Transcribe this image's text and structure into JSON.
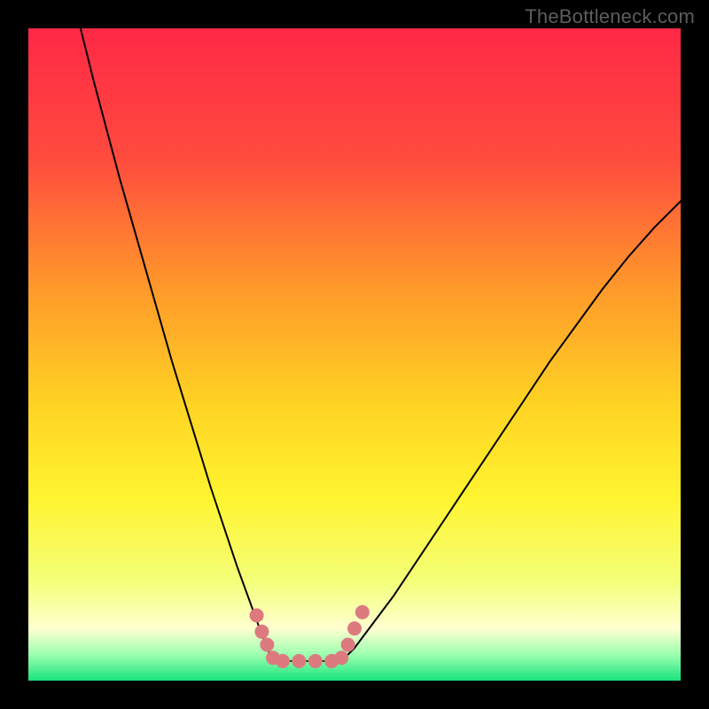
{
  "watermark": "TheBottleneck.com",
  "chart_data": {
    "type": "line",
    "title": "",
    "xlabel": "",
    "ylabel": "",
    "xlim": [
      0,
      100
    ],
    "ylim": [
      0,
      100
    ],
    "grid": false,
    "background": {
      "type": "vertical-gradient",
      "stops": [
        {
          "offset": 0,
          "color": "#ff2846"
        },
        {
          "offset": 20,
          "color": "#ff4b3e"
        },
        {
          "offset": 40,
          "color": "#ff9a2a"
        },
        {
          "offset": 58,
          "color": "#ffd423"
        },
        {
          "offset": 72,
          "color": "#fff430"
        },
        {
          "offset": 85,
          "color": "#f4ff7a"
        },
        {
          "offset": 92,
          "color": "#ffffd0"
        },
        {
          "offset": 96,
          "color": "#9dffb0"
        },
        {
          "offset": 100,
          "color": "#18e47e"
        }
      ]
    },
    "series": [
      {
        "name": "left-branch",
        "color": "#000000",
        "width": 2,
        "x": [
          8,
          10,
          12,
          14,
          16,
          18,
          20,
          22,
          24,
          26,
          28,
          30,
          32,
          34,
          36,
          37.5
        ],
        "y": [
          100,
          92,
          84.5,
          77,
          70,
          63,
          56,
          49,
          42.5,
          36,
          29.5,
          23.5,
          17.5,
          12,
          6.5,
          3
        ]
      },
      {
        "name": "right-branch",
        "color": "#000000",
        "width": 2,
        "x": [
          48,
          50,
          53,
          56,
          60,
          64,
          68,
          72,
          76,
          80,
          84,
          88,
          92,
          96,
          100
        ],
        "y": [
          3,
          5,
          9,
          13,
          19,
          25,
          31,
          37,
          43,
          49,
          54.5,
          60,
          65,
          69.5,
          73.5
        ]
      },
      {
        "name": "floor",
        "color": "#000000",
        "width": 1.5,
        "x": [
          37.5,
          48
        ],
        "y": [
          3,
          3
        ]
      }
    ],
    "markers": [
      {
        "name": "dots-left",
        "color": "#dd7a7f",
        "radius": 8,
        "points": [
          {
            "x": 35.0,
            "y": 10.0
          },
          {
            "x": 35.8,
            "y": 7.5
          },
          {
            "x": 36.6,
            "y": 5.5
          },
          {
            "x": 37.5,
            "y": 3.5
          },
          {
            "x": 39.0,
            "y": 3.0
          },
          {
            "x": 41.5,
            "y": 3.0
          },
          {
            "x": 44.0,
            "y": 3.0
          },
          {
            "x": 46.5,
            "y": 3.0
          }
        ]
      },
      {
        "name": "dots-right",
        "color": "#dd7a7f",
        "radius": 8,
        "points": [
          {
            "x": 48.0,
            "y": 3.5
          },
          {
            "x": 49.0,
            "y": 5.5
          },
          {
            "x": 50.0,
            "y": 8.0
          },
          {
            "x": 51.2,
            "y": 10.5
          }
        ]
      }
    ]
  }
}
